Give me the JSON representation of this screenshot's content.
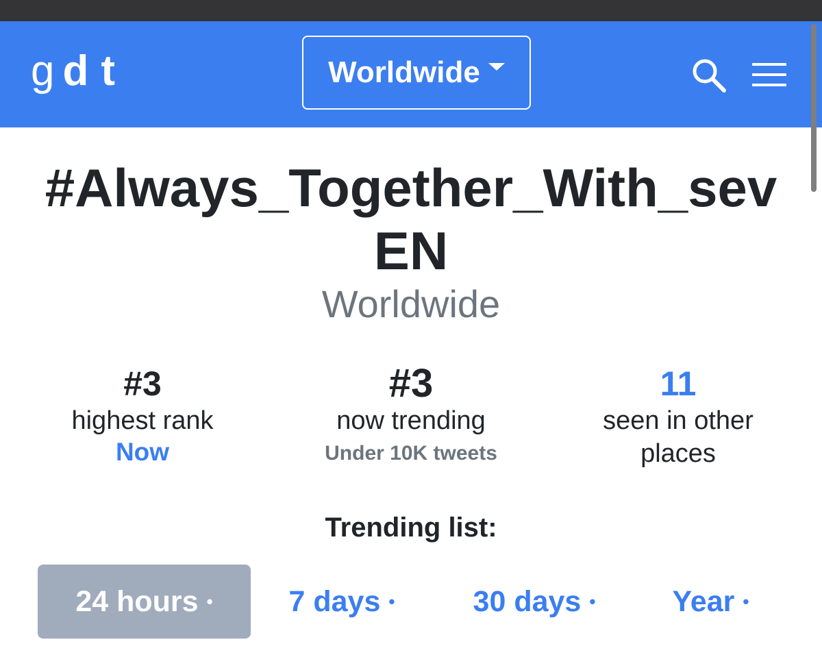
{
  "navbar": {
    "logo": {
      "g": "g",
      "d": "d",
      "t": "t"
    },
    "location_select": "Worldwide",
    "icons": {
      "search": "search-icon",
      "menu": "hamburger-menu-icon",
      "caret": "caret-down-icon"
    },
    "colors": {
      "brand": "#3b7ef0",
      "statusbar": "#343436"
    }
  },
  "trend": {
    "name": "#Always_Together_With_sevEN",
    "location": "Worldwide"
  },
  "stats": {
    "highest": {
      "value": "#3",
      "label": "highest rank",
      "sub": "Now"
    },
    "now": {
      "value": "#3",
      "label": "now trending",
      "sub": "Under 10K tweets"
    },
    "places": {
      "value": "11",
      "label": "seen in other places"
    }
  },
  "trending_list": {
    "heading": "Trending list:",
    "tabs": [
      {
        "label": "24 hours",
        "active": true
      },
      {
        "label": "7 days",
        "active": false
      },
      {
        "label": "30 days",
        "active": false
      },
      {
        "label": "Year",
        "active": false
      }
    ],
    "dot": "•"
  }
}
